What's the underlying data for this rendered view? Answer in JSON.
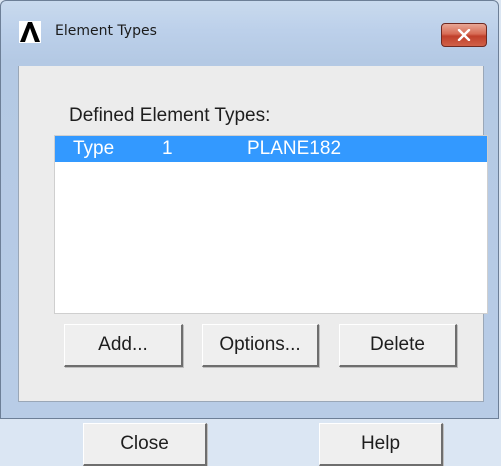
{
  "window": {
    "title": "Element Types",
    "close_icon": "close-x-icon",
    "app_icon": "ansys-lambda-icon"
  },
  "list": {
    "label": "Defined Element Types:",
    "items": [
      {
        "col1": "Type",
        "col2": "1",
        "col3": "PLANE182",
        "selected": true
      }
    ]
  },
  "buttons": {
    "add": "Add...",
    "options": "Options...",
    "delete": "Delete",
    "close": "Close",
    "help": "Help"
  },
  "colors": {
    "selection": "#3399ff",
    "dialog_bg": "#ececec",
    "close_button_red": "#c0402b"
  }
}
